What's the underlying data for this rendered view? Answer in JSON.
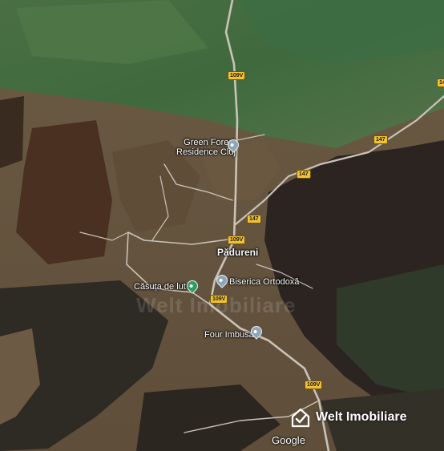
{
  "map": {
    "place_label": "Pădureni",
    "pois": [
      {
        "label": "Green Forest\nResidence Cluj",
        "icon": "pin-icon"
      },
      {
        "label": "Căsuța de lut",
        "icon": "leisure-pin-icon"
      },
      {
        "label": "Biserica Ortodoxă",
        "icon": "church-icon"
      },
      {
        "label": "Four Imbusan",
        "icon": "pin-icon"
      }
    ],
    "road_shields": {
      "route_109v": "109V",
      "route_147": "147",
      "route_147_edge": "147"
    },
    "watermark_text": "Welt Imobiliare",
    "brand": {
      "name": "Welt Imobiliare",
      "icon": "house-check-icon"
    },
    "attribution": "Google",
    "colors": {
      "road": "#c9c3b8",
      "forest": "#2d2620",
      "meadow": "#4a6a3c",
      "shield_yellow": "#f2c230",
      "shield_blue": "#3d6fd3"
    }
  }
}
